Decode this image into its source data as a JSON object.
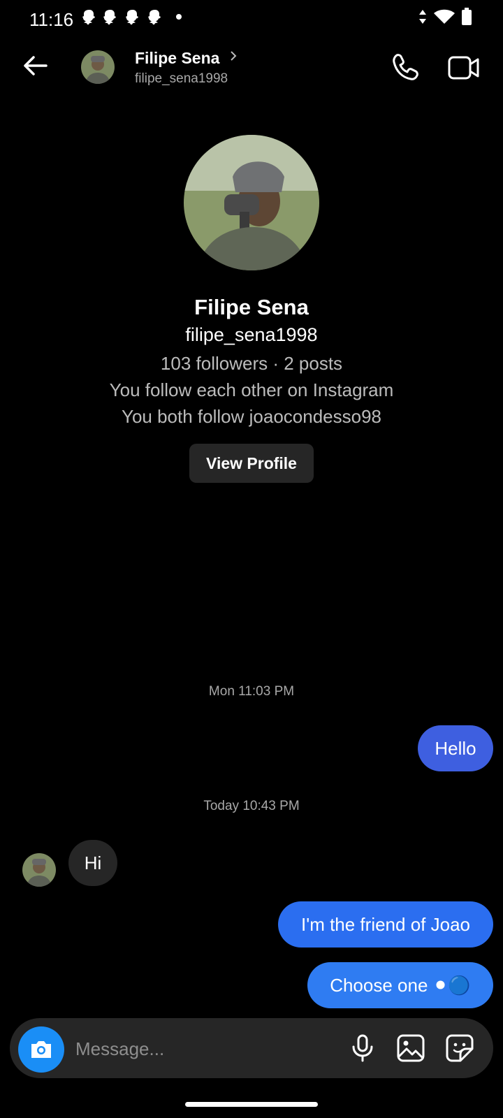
{
  "status_bar": {
    "time": "11:16",
    "notification_icons": [
      "snapchat-icon",
      "snapchat-icon",
      "snapchat-icon",
      "snapchat-icon"
    ],
    "right_icons": [
      "data-arrows-icon",
      "wifi-icon",
      "battery-icon"
    ]
  },
  "header": {
    "name": "Filipe Sena",
    "username": "filipe_sena1998",
    "icons": [
      "back-arrow-icon",
      "chevron-right-icon",
      "phone-icon",
      "video-camera-icon"
    ]
  },
  "profile": {
    "name": "Filipe Sena",
    "username": "filipe_sena1998",
    "stats": "103 followers · 2 posts",
    "mutual_line_1": "You follow each other on Instagram",
    "mutual_line_2": "You both follow joaocondesso98",
    "view_profile_label": "View Profile"
  },
  "messages": {
    "timestamp_1": "Mon 11:03 PM",
    "hello": "Hello",
    "timestamp_2": "Today 10:43 PM",
    "hi": "Hi",
    "friend": "I'm the friend of Joao",
    "choose": "Choose one ⚫🔵"
  },
  "composer": {
    "placeholder": "Message...",
    "icons": [
      "camera-icon",
      "microphone-icon",
      "gallery-icon",
      "sticker-icon"
    ]
  },
  "colors": {
    "background": "#000000",
    "sent_bubble": "#2b6ef0",
    "received_bubble": "#262626",
    "camera_button": "#1a8ef6"
  }
}
